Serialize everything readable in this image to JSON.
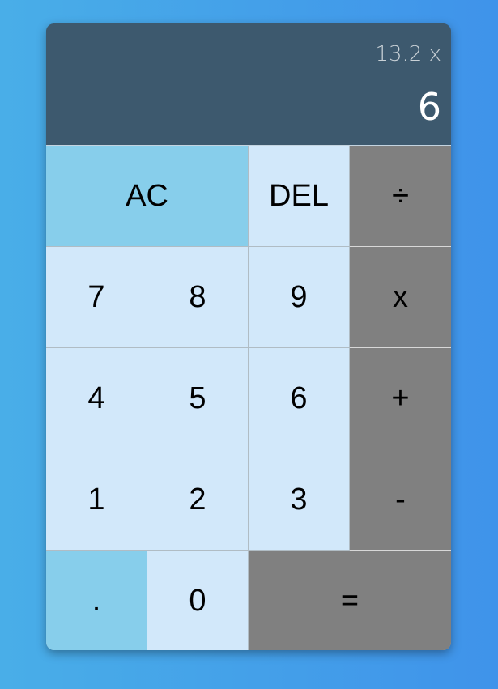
{
  "display": {
    "previous": "13.2 x",
    "current": "6"
  },
  "keys": {
    "clear": "AC",
    "delete": "DEL",
    "divide": "÷",
    "seven": "7",
    "eight": "8",
    "nine": "9",
    "multiply": "x",
    "four": "4",
    "five": "5",
    "six": "6",
    "plus": "+",
    "one": "1",
    "two": "2",
    "three": "3",
    "minus": "-",
    "dot": ".",
    "zero": "0",
    "equals": "="
  },
  "colors": {
    "display_bg": "#3d596e",
    "key_bg": "#d2e8fa",
    "accent_key_bg": "#87ceeb",
    "operator_key_bg": "#808080"
  }
}
